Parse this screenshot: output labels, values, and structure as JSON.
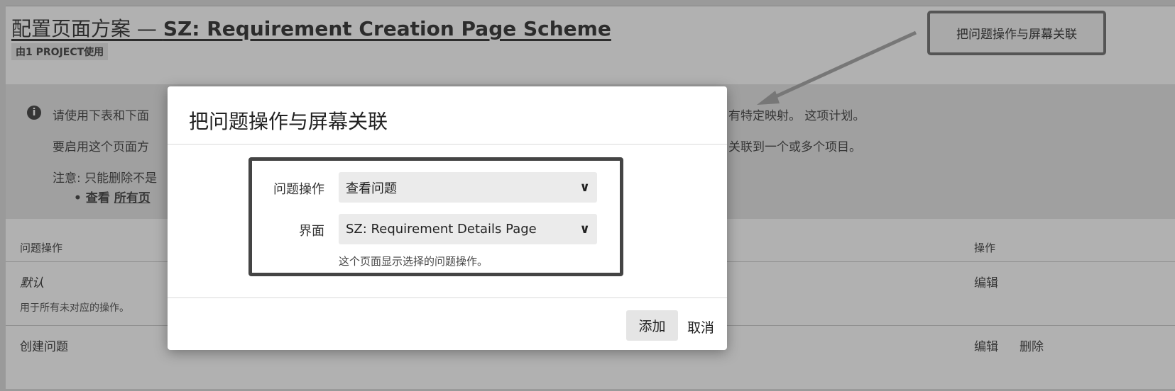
{
  "page": {
    "title_cn": "配置页面方案",
    "title_dash": " — ",
    "title_en": "SZ: Requirement Creation Page Scheme",
    "usage": "由1 PROJECT使用",
    "associate_button": "把问题操作与屏幕关联"
  },
  "info": {
    "icon": "info-icon",
    "line1_start": "请使用下表和下面",
    "line1_end": "有特定映射。 这项计划。",
    "line2_start": "要启用这个页面方",
    "line2_end": "关联到一个或多个项目。",
    "line3_start": "注意: 只能删除不是",
    "bullet_view": "查看",
    "bullet_link": "所有页"
  },
  "table": {
    "col_operation": "问题操作",
    "col_actions": "操作",
    "rows": [
      {
        "name": "默认",
        "desc": "用于所有未对应的操作。",
        "edit": "编辑"
      },
      {
        "name": "创建问题",
        "edit": "编辑",
        "delete": "删除"
      }
    ]
  },
  "dialog": {
    "title": "把问题操作与屏幕关联",
    "operation_label": "问题操作",
    "operation_value": "查看问题",
    "screen_label": "界面",
    "screen_value": "SZ: Requirement Details Page",
    "hint": "这个页面显示选择的问题操作。",
    "add_button": "添加",
    "cancel_link": "取消"
  },
  "colors": {
    "overlay": "rgba(60,60,60,0.40)",
    "frame": "#444444",
    "arrow": "#777777"
  }
}
